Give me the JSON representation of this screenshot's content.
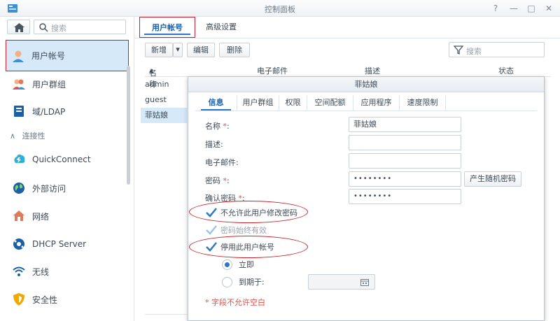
{
  "window": {
    "title": "控制面板"
  },
  "sidebar": {
    "search_placeholder": "搜索",
    "items": [
      {
        "label": "用户帐号",
        "icon": "user-icon"
      },
      {
        "label": "用户群组",
        "icon": "users-icon"
      },
      {
        "label": "域/LDAP",
        "icon": "domain-icon"
      },
      {
        "label": "QuickConnect",
        "icon": "quickconnect-icon"
      },
      {
        "label": "外部访问",
        "icon": "globe-icon"
      },
      {
        "label": "网络",
        "icon": "network-icon"
      },
      {
        "label": "DHCP Server",
        "icon": "dhcp-icon"
      },
      {
        "label": "无线",
        "icon": "wifi-icon"
      },
      {
        "label": "安全性",
        "icon": "shield-icon"
      }
    ],
    "section_connectivity": "连接性"
  },
  "main": {
    "tabs": [
      {
        "label": "用户帐号"
      },
      {
        "label": "高级设置"
      }
    ],
    "toolbar": {
      "create": "新增",
      "edit": "编辑",
      "delete": "删除",
      "filter_placeholder": "搜索"
    },
    "columns": {
      "name": "名称",
      "email": "电子邮件",
      "description": "描述",
      "status": "状态"
    },
    "rows": [
      {
        "name": "admin"
      },
      {
        "name": "guest"
      },
      {
        "name": "菲姑娘"
      }
    ]
  },
  "dialog": {
    "title": "菲姑娘",
    "tabs": [
      {
        "label": "信息"
      },
      {
        "label": "用户群组"
      },
      {
        "label": "权限"
      },
      {
        "label": "空间配额"
      },
      {
        "label": "应用程序"
      },
      {
        "label": "速度限制"
      }
    ],
    "fields": {
      "name_label": "名称",
      "name_value": "菲姑娘",
      "description_label": "描述:",
      "email_label": "电子邮件:",
      "password_label": "密码",
      "password_value": "••••••••",
      "confirm_label": "确认密码",
      "confirm_value": "••••••••",
      "required_mark": "*",
      "colon": ":"
    },
    "generate_password": "产生随机密码",
    "checkboxes": {
      "no_change_password": "不允许此用户修改密码",
      "password_never_expires": "密码始终有效",
      "disable_account": "停用此用户帐号"
    },
    "radios": {
      "immediately": "立即",
      "until": "到期于:"
    },
    "note": "* 字段不允许空白"
  }
}
